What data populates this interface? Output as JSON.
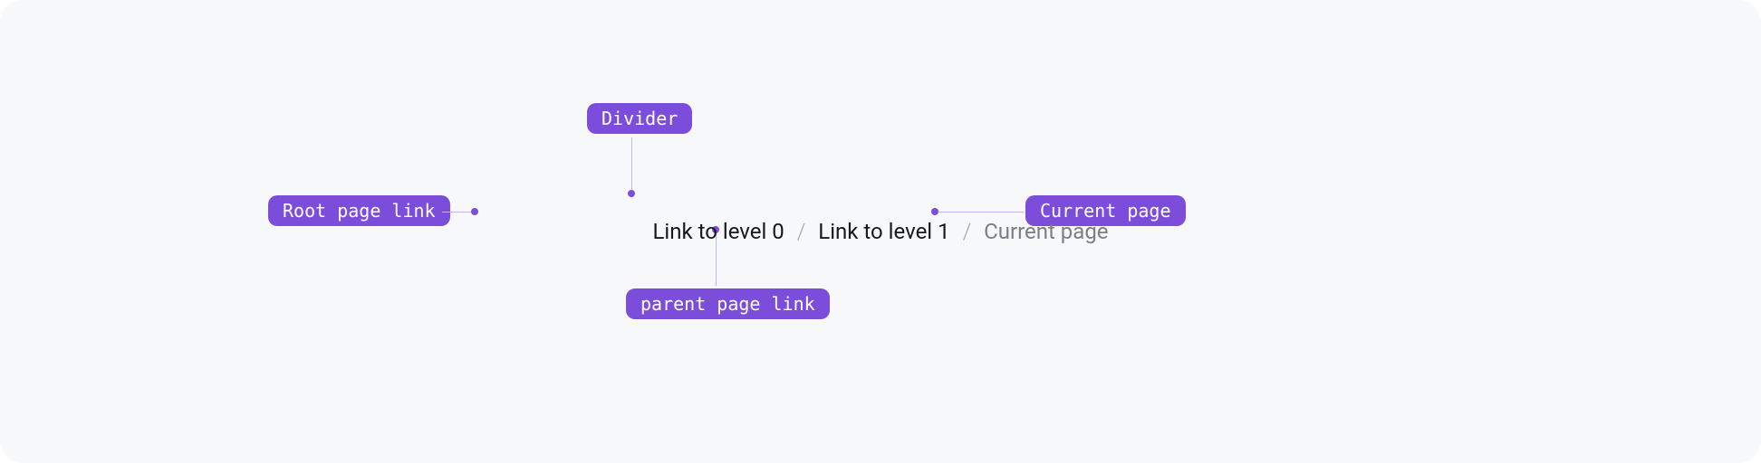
{
  "breadcrumb": {
    "level0": "Link to level 0",
    "level1": "Link to level 1",
    "current": "Current page",
    "separator": "/"
  },
  "annotations": {
    "root": "Root page link",
    "divider": "Divider",
    "parent": "parent page link",
    "current": "Current page"
  },
  "colors": {
    "accent": "#7c4ddb",
    "connector": "#c9b3ef",
    "canvas_bg": "#f7f8fa",
    "text_primary": "#18181b",
    "text_muted": "#7a7e87"
  }
}
